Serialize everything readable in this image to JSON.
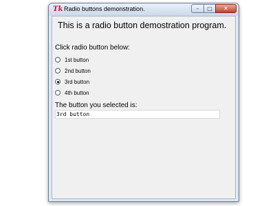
{
  "window": {
    "title": "Radio buttons demonstration.",
    "icon_glyph": "Tk",
    "controls": {
      "minimize": "–",
      "maximize": "□",
      "close": "✕"
    }
  },
  "content": {
    "heading": "This is a radio button demostration program.",
    "prompt": "Click radio button below:",
    "radio_options": [
      {
        "label": "1st button",
        "selected": false
      },
      {
        "label": "2nd button",
        "selected": false
      },
      {
        "label": "3rd button",
        "selected": true
      },
      {
        "label": "4th button",
        "selected": false
      }
    ],
    "result_label": "The button you selected is:",
    "result_value": "3rd button"
  },
  "colors": {
    "icon": "#c8102e",
    "client_bg": "#f0f0f0",
    "close_button": "#c8402a"
  }
}
